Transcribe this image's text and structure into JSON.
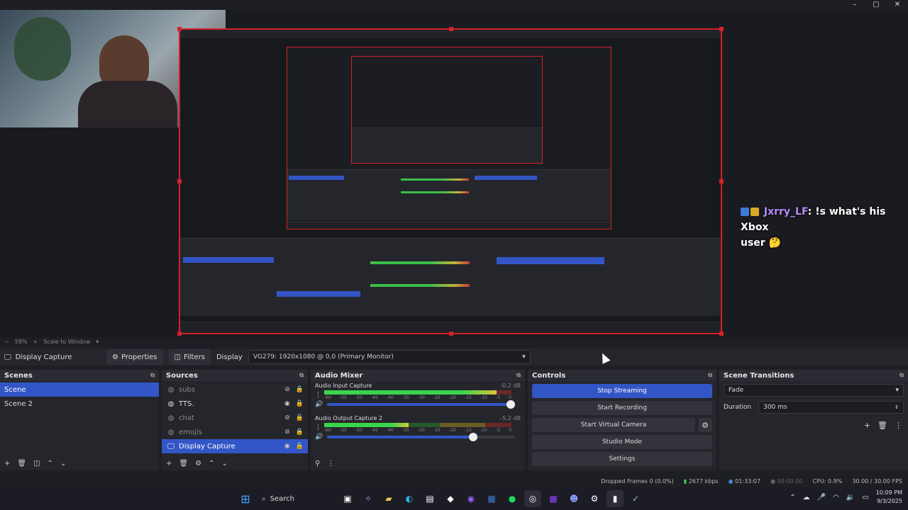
{
  "window_controls": [
    "–",
    "▢",
    "✕"
  ],
  "preview": {
    "chat": [
      {
        "user": "Jxrry_LF",
        "text": ": !s what's his Xbox",
        "line2": "user 🤔"
      }
    ],
    "zoom": "59%",
    "scale": "Scale to Window"
  },
  "source_bar": {
    "source_name": "Display Capture",
    "properties": "Properties",
    "filters": "Filters",
    "display_label": "Display",
    "display_value": "VG279: 1920x1080 @ 0,0 (Primary Monitor)"
  },
  "scenes": {
    "title": "Scenes",
    "items": [
      "Scene",
      "Scene 2"
    ],
    "selected": 0
  },
  "sources": {
    "title": "Sources",
    "items": [
      {
        "name": "subs",
        "visible": false
      },
      {
        "name": "TTS.",
        "visible": true
      },
      {
        "name": "chat",
        "visible": false
      },
      {
        "name": "emojis",
        "visible": false
      },
      {
        "name": "Display Capture",
        "visible": true
      }
    ],
    "selected": 4
  },
  "mixer": {
    "title": "Audio Mixer",
    "scale": [
      "-60",
      "-55",
      "-50",
      "-45",
      "-40",
      "-35",
      "-30",
      "-25",
      "-20",
      "-15",
      "-10",
      "-5",
      "0"
    ],
    "channels": [
      {
        "name": "Audio Input Capture",
        "db": "-0.2 dB",
        "level": 0.92,
        "volume": 0.98
      },
      {
        "name": "Audio Output Capture 2",
        "db": "-5.2 dB",
        "level": 0.45,
        "volume": 0.78
      }
    ]
  },
  "controls": {
    "title": "Controls",
    "stop_streaming": "Stop Streaming",
    "start_recording": "Start Recording",
    "start_virtual_camera": "Start Virtual Camera",
    "studio_mode": "Studio Mode",
    "settings": "Settings"
  },
  "transitions": {
    "title": "Scene Transitions",
    "type": "Fade",
    "duration_label": "Duration",
    "duration_value": "300 ms"
  },
  "status": {
    "dropped": "Dropped Frames 0 (0.0%)",
    "bitrate": "2677 kbps",
    "stream_time": "01:33:07",
    "rec_time": "00:00:00",
    "cpu": "CPU: 0.9%",
    "fps": "30.00 / 30.00 FPS"
  },
  "taskbar": {
    "search": "Search",
    "time": "10:09 PM",
    "date": "9/3/2025"
  },
  "colors": {
    "accent": "#3356c6",
    "selection_border": "#d0222a"
  }
}
